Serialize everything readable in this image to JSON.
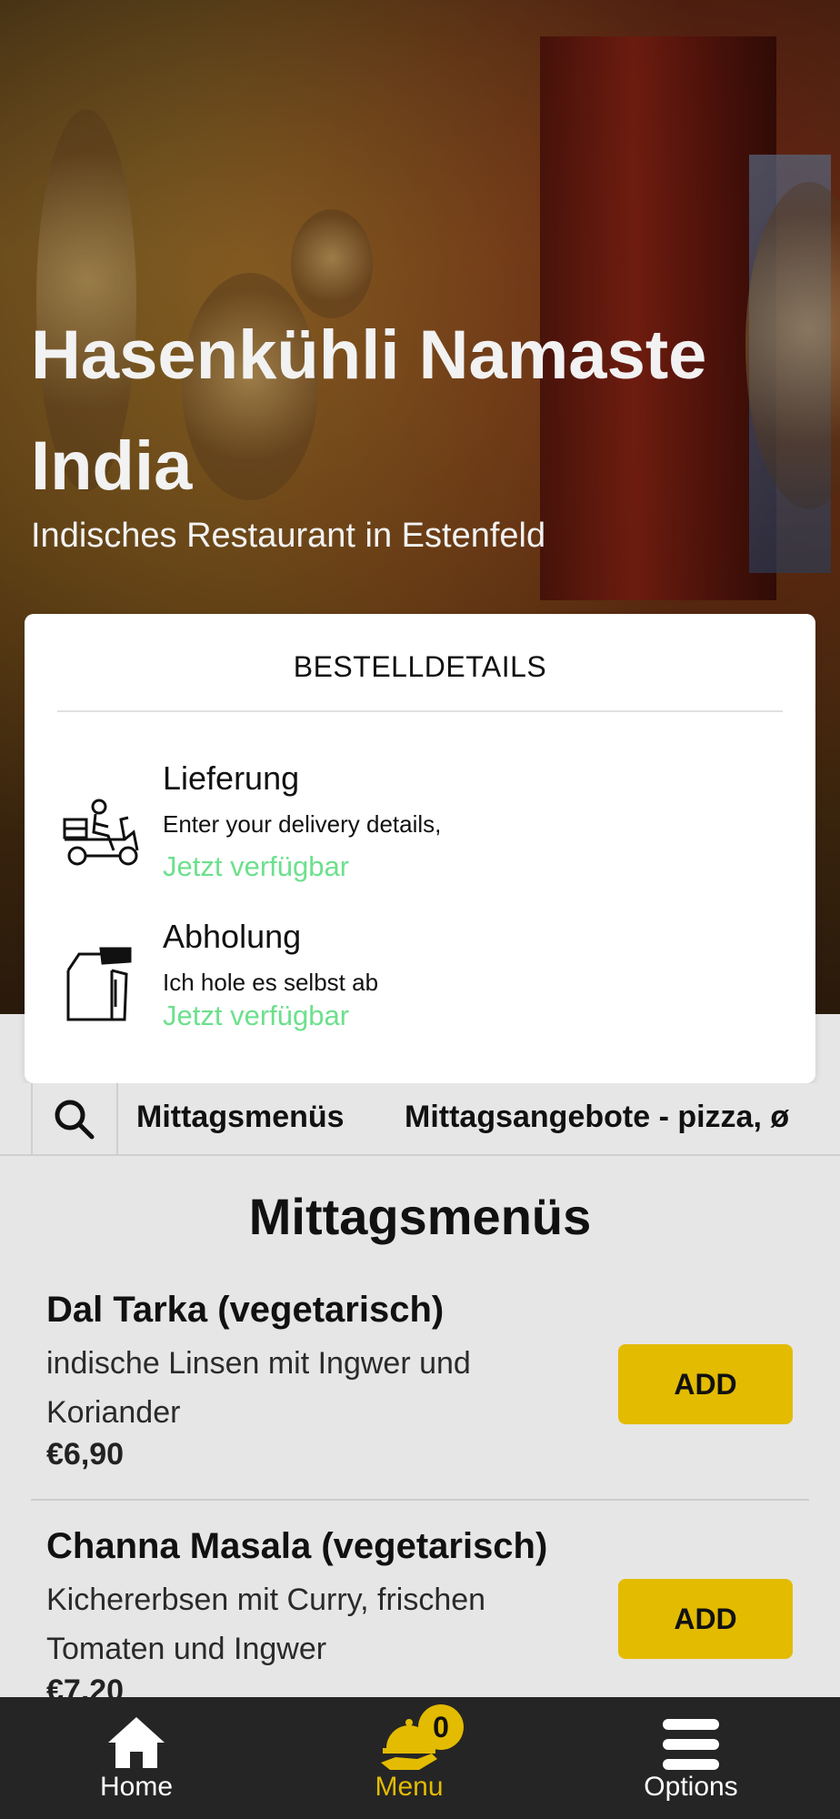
{
  "hero": {
    "title": "Hasenkühli Namaste India",
    "subtitle": "Indisches Restaurant in Estenfeld"
  },
  "order_details": {
    "title": "BESTELLDETAILS",
    "options": [
      {
        "name": "Lieferung",
        "description": "Enter your delivery details,",
        "status": "Jetzt verfügbar",
        "icon": "delivery-scooter-icon"
      },
      {
        "name": "Abholung",
        "description": "Ich hole es selbst ab",
        "status": "Jetzt verfügbar",
        "icon": "pickup-bag-icon"
      }
    ]
  },
  "categories": {
    "search_icon": "search-icon",
    "items": [
      "Mittagsmenüs",
      "Mittagsangebote - pizza, ø"
    ]
  },
  "menu": {
    "section_title": "Mittagsmenüs",
    "items": [
      {
        "name": "Dal Tarka (vegetarisch)",
        "description": "indische Linsen mit Ingwer und Koriander",
        "price": "€6,90",
        "button": "ADD"
      },
      {
        "name": "Channa Masala (vegetarisch)",
        "description": "Kichererbsen mit Curry, frischen Tomaten und Ingwer",
        "price": "€7,20",
        "button": "ADD"
      }
    ]
  },
  "bottom_nav": {
    "items": [
      {
        "label": "Home",
        "icon": "home-icon",
        "active": false
      },
      {
        "label": "Menu",
        "icon": "menu-cloche-icon",
        "active": true,
        "badge": "0"
      },
      {
        "label": "Options",
        "icon": "hamburger-icon",
        "active": false
      }
    ]
  },
  "colors": {
    "accent": "#e3bb00",
    "available": "#6de08d",
    "nav_background": "#252525"
  }
}
